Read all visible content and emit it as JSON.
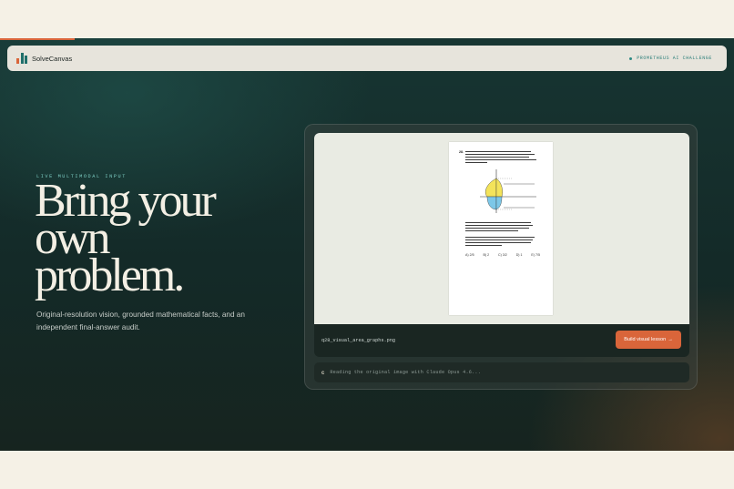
{
  "navbar": {
    "brand": "SolveCanvas",
    "badge": "PROMETHEUS AI CHALLENGE"
  },
  "hero": {
    "eyebrow": "LIVE MULTIMODAL INPUT",
    "headline": [
      "Bring your",
      "own",
      "problem."
    ],
    "subcopy": "Original-resolution vision, grounded mathematical facts, and an independent final-answer audit."
  },
  "viewer": {
    "question_number": "28.",
    "answer_choices": [
      "A) 2/5",
      "B) 2",
      "C) 3/2",
      "D) 1",
      "E) 7/5"
    ],
    "filename": "q28_visual_area_graphs.png",
    "button_label": "Build visual lesson",
    "button_arrow": "→"
  },
  "status": {
    "icon": "C",
    "text": "Reading the original image with Claude Opus 4.6..."
  },
  "colors": {
    "accent": "#d9653a",
    "teal": "#1f6f6b",
    "background": "#f5f1e6",
    "hero_dark": "#142a28"
  }
}
